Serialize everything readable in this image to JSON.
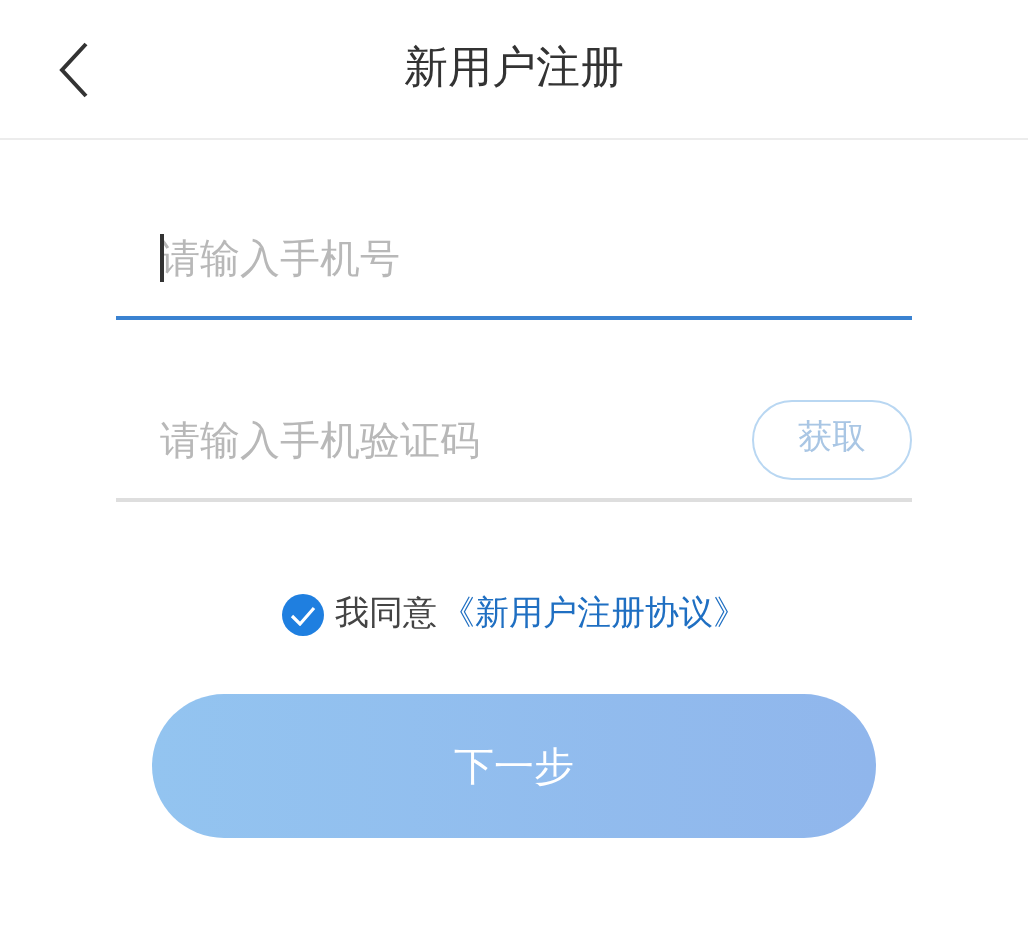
{
  "header": {
    "title": "新用户注册"
  },
  "fields": [
    {
      "placeholder": "请输入手机号",
      "focused": true
    },
    {
      "placeholder": "请输入手机验证码",
      "focused": false,
      "button": {
        "label": "获取",
        "disabled": true
      }
    }
  ],
  "agreement": {
    "checked": true,
    "text": "我同意",
    "link": "《新用户注册协议》"
  },
  "next_button": {
    "label": "下一步",
    "disabled": true
  }
}
